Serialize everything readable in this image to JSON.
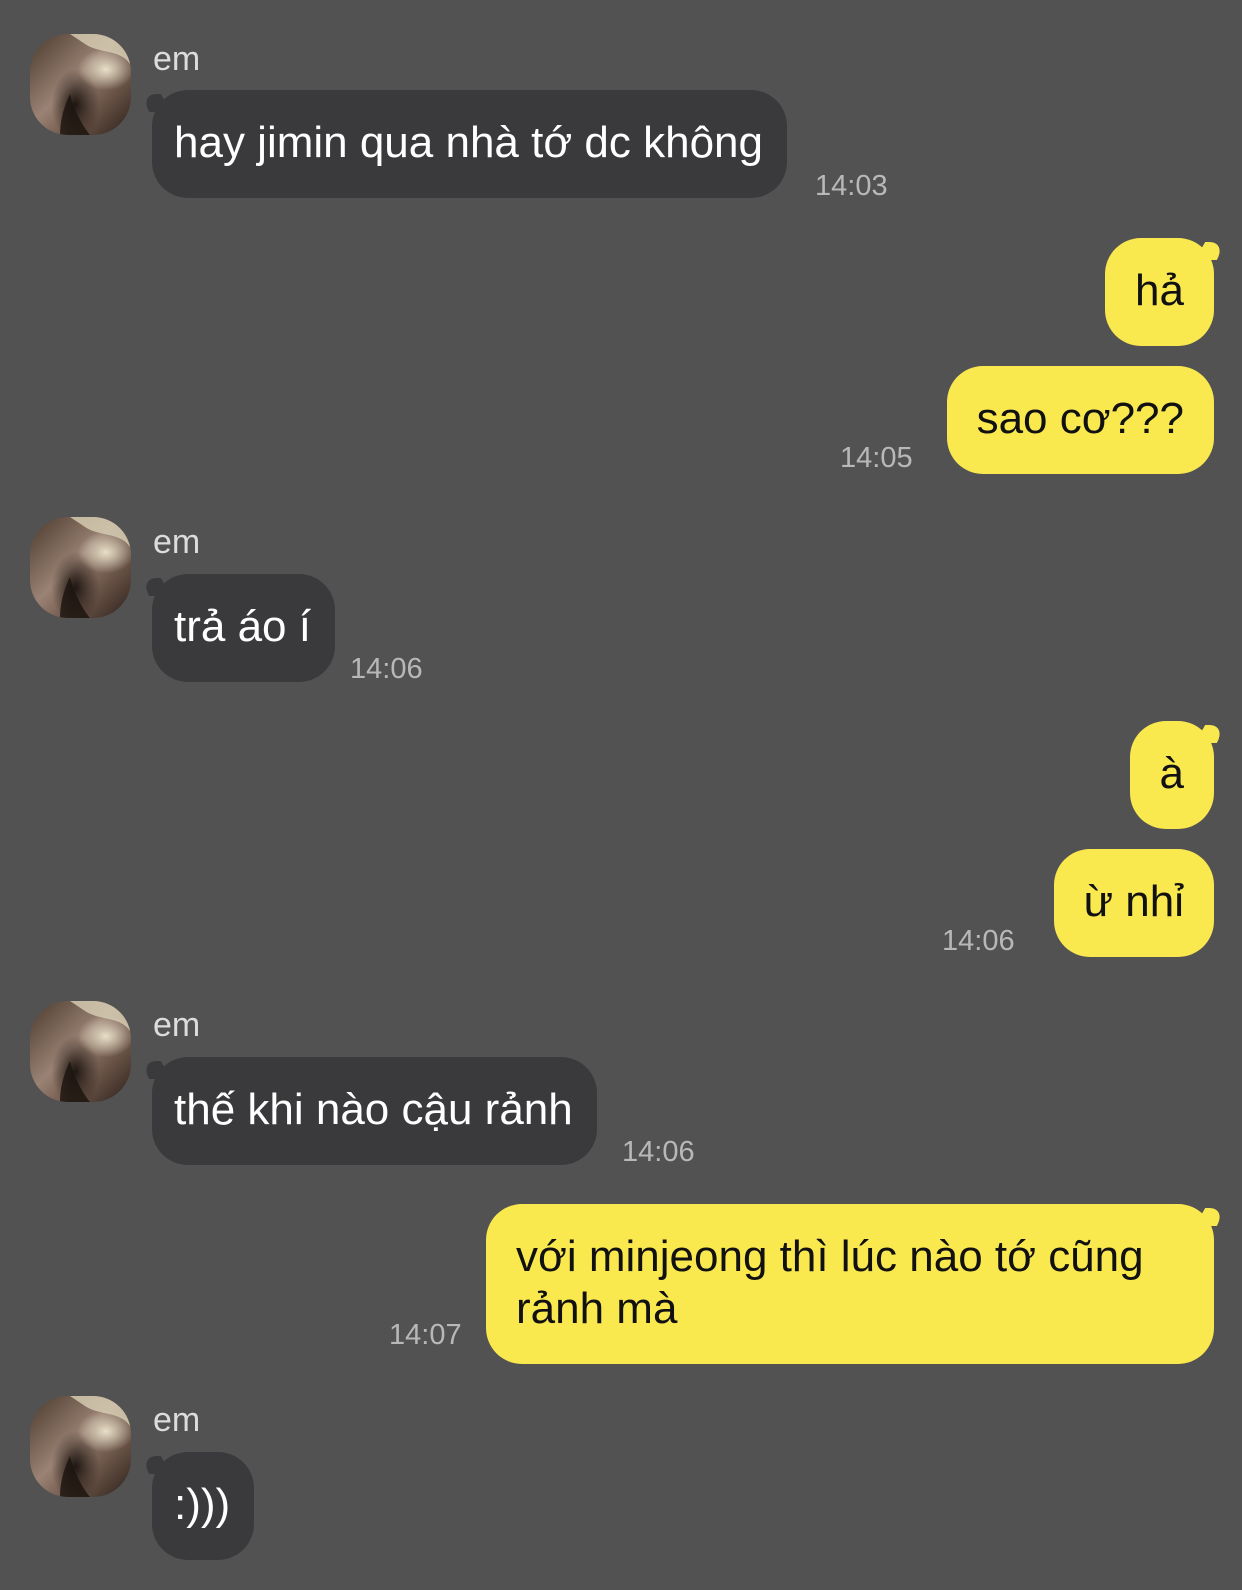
{
  "colors": {
    "background": "#535253",
    "incoming_bubble": "#3a393b",
    "outgoing_bubble": "#fae84f",
    "timestamp": "#b9b8b9",
    "sender_name": "#dcdcdc"
  },
  "messages": [
    {
      "direction": "incoming",
      "sender": "em",
      "text": "hay jimin qua nhà tớ dc không",
      "time": "14:03"
    },
    {
      "direction": "outgoing",
      "text": "hả",
      "time": ""
    },
    {
      "direction": "outgoing",
      "text": "sao cơ???",
      "time": "14:05"
    },
    {
      "direction": "incoming",
      "sender": "em",
      "text": "trả áo í",
      "time": "14:06"
    },
    {
      "direction": "outgoing",
      "text": "à",
      "time": ""
    },
    {
      "direction": "outgoing",
      "text": "ừ nhỉ",
      "time": "14:06"
    },
    {
      "direction": "incoming",
      "sender": "em",
      "text": "thế khi nào cậu rảnh",
      "time": "14:06"
    },
    {
      "direction": "outgoing",
      "text": "với minjeong thì lúc nào tớ cũng rảnh mà",
      "time": "14:07"
    },
    {
      "direction": "incoming",
      "sender": "em",
      "text": ":)))",
      "time": ""
    }
  ]
}
